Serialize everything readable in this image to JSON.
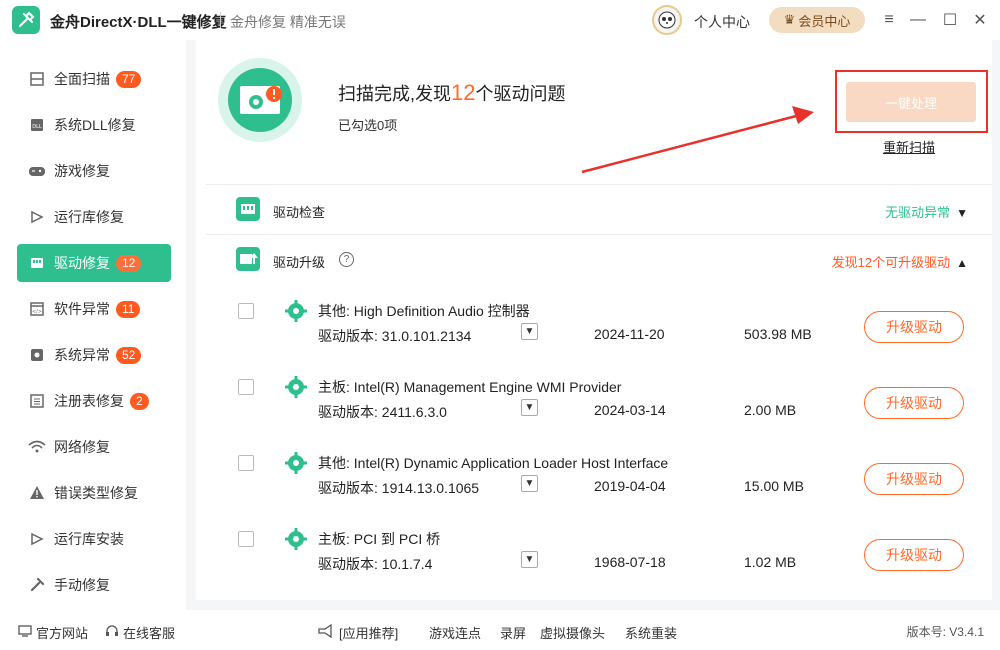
{
  "app": {
    "title": "金舟DirectX·DLL一键修复",
    "slogan": "金舟修复 精准无误",
    "personal_center": "个人中心",
    "vip_center": "会员中心"
  },
  "sidebar": {
    "items": [
      {
        "label": "全面扫描",
        "badge": "77"
      },
      {
        "label": "系统DLL修复",
        "badge": ""
      },
      {
        "label": "游戏修复",
        "badge": ""
      },
      {
        "label": "运行库修复",
        "badge": ""
      },
      {
        "label": "驱动修复",
        "badge": "12"
      },
      {
        "label": "软件异常",
        "badge": "11"
      },
      {
        "label": "系统异常",
        "badge": "52"
      },
      {
        "label": "注册表修复",
        "badge": "2"
      },
      {
        "label": "网络修复",
        "badge": ""
      },
      {
        "label": "错误类型修复",
        "badge": ""
      },
      {
        "label": "运行库安装",
        "badge": ""
      },
      {
        "label": "手动修复",
        "badge": ""
      }
    ]
  },
  "scan": {
    "title_prefix": "扫描完成,发现",
    "count": "12",
    "title_suffix": "个驱动问题",
    "selected": "已勾选0项",
    "fix_button": "一键处理",
    "rescan": "重新扫描"
  },
  "sections": {
    "check": {
      "label": "驱动检查",
      "status": "无驱动异常"
    },
    "upgrade": {
      "label": "驱动升级",
      "status": "发现12个可升级驱动",
      "help": "?"
    }
  },
  "drivers": [
    {
      "name": "其他: High Definition Audio 控制器",
      "version_label": "驱动版本: 31.0.101.2134",
      "date": "2024-11-20",
      "size": "503.98 MB",
      "action": "升级驱动"
    },
    {
      "name": "主板: Intel(R) Management Engine WMI Provider",
      "version_label": "驱动版本: 2411.6.3.0",
      "date": "2024-03-14",
      "size": "2.00 MB",
      "action": "升级驱动"
    },
    {
      "name": "其他: Intel(R) Dynamic Application Loader Host Interface",
      "version_label": "驱动版本: 1914.13.0.1065",
      "date": "2019-04-04",
      "size": "15.00 MB",
      "action": "升级驱动"
    },
    {
      "name": "主板: PCI 到 PCI 桥",
      "version_label": "驱动版本: 10.1.7.4",
      "date": "1968-07-18",
      "size": "1.02 MB",
      "action": "升级驱动"
    }
  ],
  "footer": {
    "official_site": "官方网站",
    "online_service": "在线客服",
    "recommend": "[应用推荐]",
    "links": [
      "游戏连点",
      "录屏",
      "虚拟摄像头",
      "系统重装"
    ],
    "version": "版本号: V3.4.1"
  },
  "colors": {
    "accent": "#2fbf8f",
    "warning": "#ff5a1f",
    "highlight_box": "#e8312a"
  }
}
